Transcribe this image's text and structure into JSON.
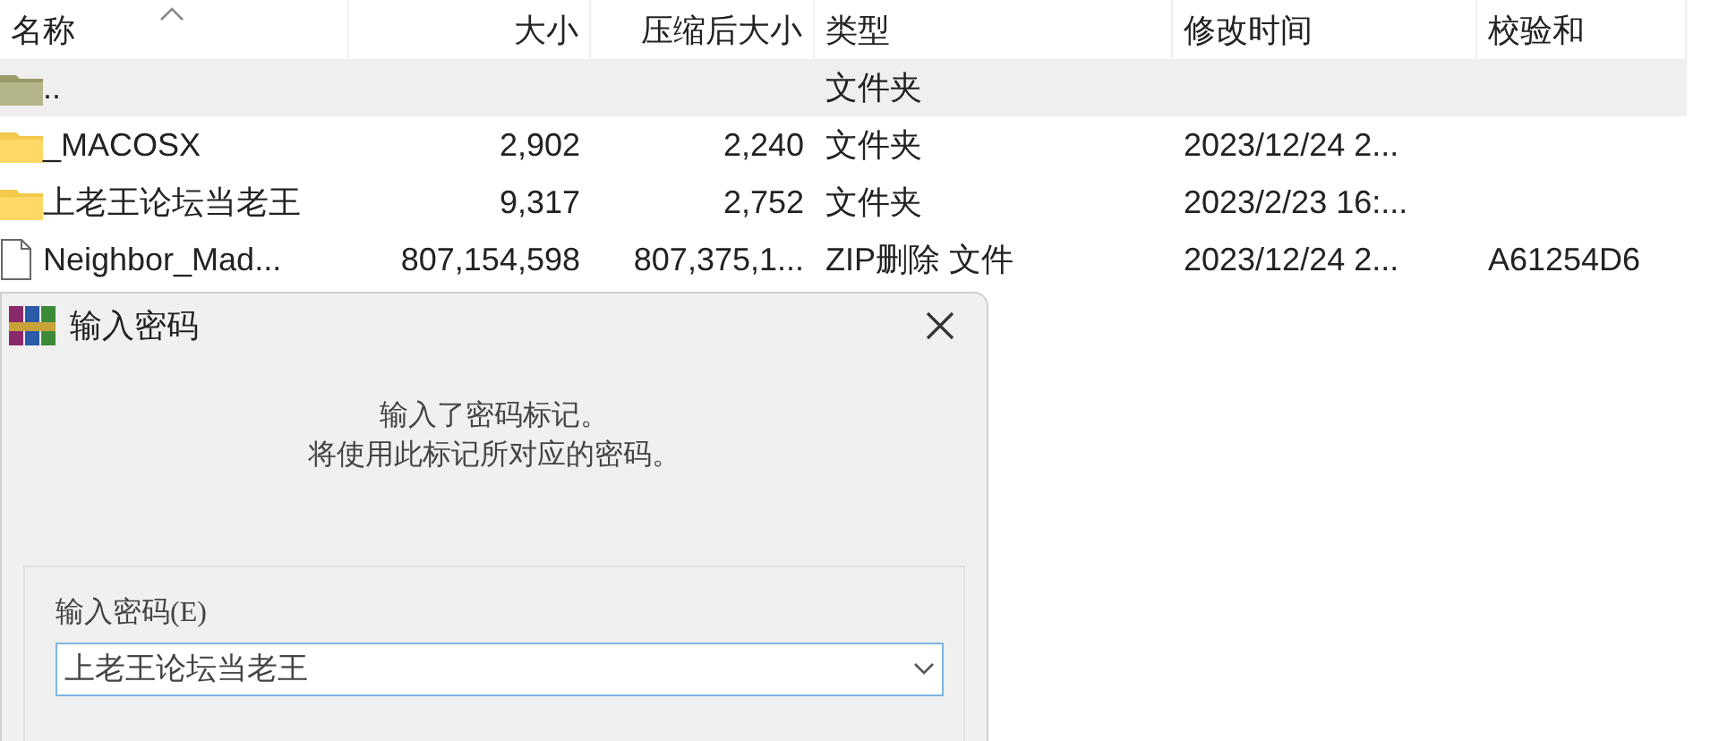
{
  "file_list": {
    "columns": [
      {
        "label": "名称",
        "sorted": true
      },
      {
        "label": "大小",
        "sorted": false
      },
      {
        "label": "压缩后大小",
        "sorted": false
      },
      {
        "label": "类型",
        "sorted": false
      },
      {
        "label": "修改时间",
        "sorted": false
      },
      {
        "label": "校验和",
        "sorted": false
      }
    ],
    "rows": [
      {
        "kind": "parent",
        "selected": true,
        "name": "..",
        "size": "",
        "packed": "",
        "type": "文件夹",
        "modified": "",
        "checksum": ""
      },
      {
        "kind": "folder",
        "selected": false,
        "name": "_MACOSX",
        "size": "2,902",
        "packed": "2,240",
        "type": "文件夹",
        "modified": "2023/12/24 2...",
        "checksum": ""
      },
      {
        "kind": "folder",
        "selected": false,
        "name": "上老王论坛当老王",
        "size": "9,317",
        "packed": "2,752",
        "type": "文件夹",
        "modified": "2023/2/23 16:...",
        "checksum": ""
      },
      {
        "kind": "file",
        "selected": false,
        "name": "Neighbor_Mad...",
        "size": "807,154,598",
        "packed": "807,375,1...",
        "type": "ZIP删除 文件",
        "modified": "2023/12/24 2...",
        "checksum": "A61254D6"
      }
    ]
  },
  "dialog": {
    "title": "输入密码",
    "message": [
      "输入了密码标记。",
      "将使用此标记所对应的密码。"
    ],
    "password_field": {
      "label": "输入密码(E)",
      "value": "上老王论坛当老王"
    }
  }
}
